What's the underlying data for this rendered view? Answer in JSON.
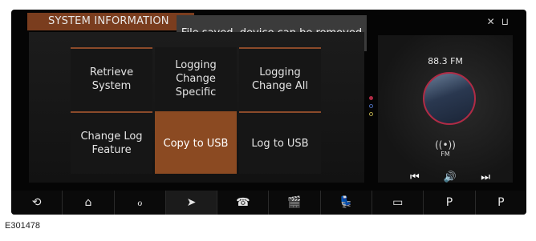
{
  "title": "SYSTEM INFORMATION",
  "toast": "File saved, device can be removed",
  "tiles": [
    {
      "label": "Retrieve System"
    },
    {
      "label": "Logging Change Specific"
    },
    {
      "label": "Logging Change All"
    },
    {
      "label": "Change Log Feature"
    },
    {
      "label": "Copy to USB",
      "selected": true
    },
    {
      "label": "Log to USB"
    }
  ],
  "radio": {
    "frequency": "88.3 FM",
    "antenna_label": "FM",
    "prev": "⏮",
    "volume": "🔊",
    "next": "⏭"
  },
  "nav": [
    {
      "icon": "back-icon",
      "glyph": "⟲"
    },
    {
      "icon": "home-icon",
      "glyph": "⌂"
    },
    {
      "icon": "connect-icon",
      "glyph": "ℴ"
    },
    {
      "icon": "navigation-icon",
      "glyph": "➤"
    },
    {
      "icon": "phone-icon",
      "glyph": "☎"
    },
    {
      "icon": "media-icon",
      "glyph": "🎬"
    },
    {
      "icon": "seat-icon",
      "glyph": "💺"
    },
    {
      "icon": "camera-icon",
      "glyph": "▭"
    },
    {
      "icon": "p-assist-icon",
      "glyph": "P"
    },
    {
      "icon": "park-exit-icon",
      "glyph": "P"
    }
  ],
  "figure_id": "E301478",
  "colors": {
    "accent": "#8b4a22",
    "ring": "#b02b45"
  }
}
